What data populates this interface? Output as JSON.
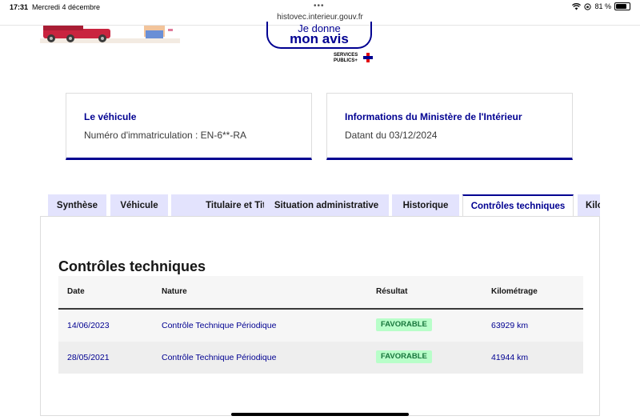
{
  "status_bar": {
    "time": "17:31",
    "date": "Mercredi 4 décembre",
    "url": "histovec.interieur.gouv.fr",
    "battery": "81 %",
    "battery_level": 0.81
  },
  "header": {
    "avis_line1": "Je donne",
    "avis_line2": "mon avis",
    "services_logo_line1": "SERVICES",
    "services_logo_line2": "PUBLICS+"
  },
  "cards": {
    "vehicle": {
      "title": "Le véhicule",
      "text": "Numéro d'immatriculation : EN-6**-RA"
    },
    "ministry": {
      "title": "Informations du Ministère de l'Intérieur",
      "text": "Datant du 03/12/2024"
    }
  },
  "tabs": [
    {
      "label": "Synthèse"
    },
    {
      "label": "Véhicule"
    },
    {
      "label": "Titulaire et Titre"
    },
    {
      "label": "Situation administrative"
    },
    {
      "label": "Historique"
    },
    {
      "label": "Contrôles techniques"
    },
    {
      "label": "Kilo"
    }
  ],
  "active_tab": "Contrôles techniques",
  "section": {
    "title": "Contrôles techniques",
    "columns": [
      "Date",
      "Nature",
      "Résultat",
      "Kilométrage"
    ],
    "rows": [
      {
        "date": "14/06/2023",
        "nature": "Contrôle Technique Périodique",
        "result": "FAVORABLE",
        "km": "63929 km"
      },
      {
        "date": "28/05/2021",
        "nature": "Contrôle Technique Périodique",
        "result": "FAVORABLE",
        "km": "41944 km"
      }
    ]
  },
  "colors": {
    "primary": "#000091",
    "tab_bg": "#e3e3fd",
    "badge_bg": "#b8fec9",
    "badge_text": "#18753c"
  }
}
